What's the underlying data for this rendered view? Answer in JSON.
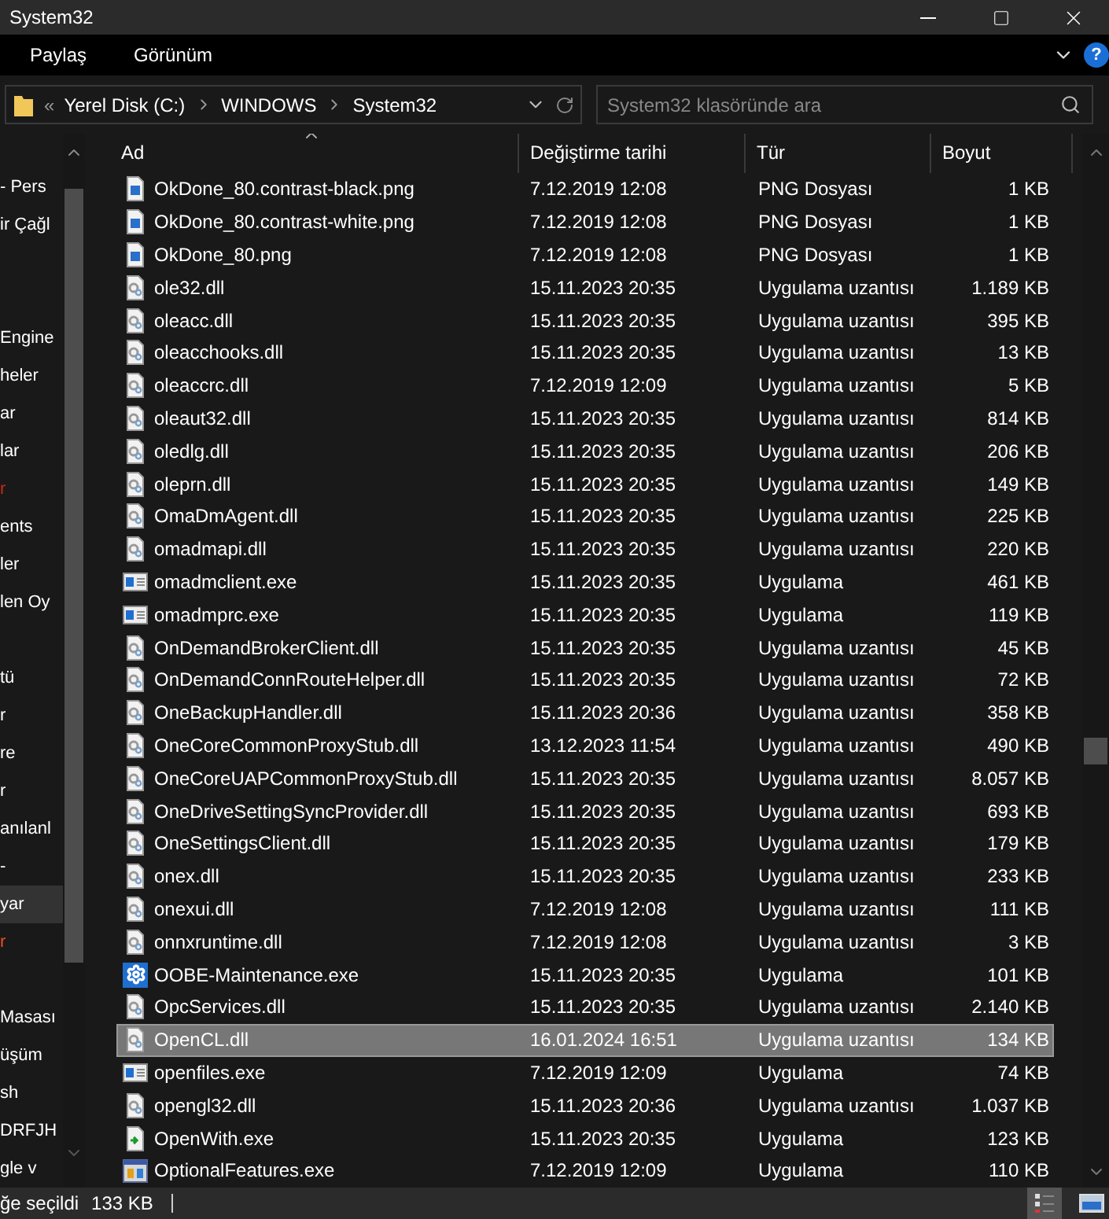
{
  "window": {
    "title": "System32"
  },
  "ribbon": {
    "tabs": [
      {
        "label": "Paylaş",
        "selected": false
      },
      {
        "label": "Görünüm",
        "selected": false
      }
    ],
    "help": "?"
  },
  "address": {
    "overflow": "«",
    "crumbs": [
      "Yerel Disk (C:)",
      "WINDOWS",
      "System32"
    ]
  },
  "search": {
    "placeholder": "System32 klasöründe ara"
  },
  "nav": {
    "items": [
      {
        "kind": "item",
        "label": "- Pers",
        "selected": false
      },
      {
        "kind": "item",
        "label": "ir Çağl",
        "selected": false
      },
      {
        "kind": "gap"
      },
      {
        "kind": "gap"
      },
      {
        "kind": "item",
        "label": "Engine",
        "selected": false
      },
      {
        "kind": "item",
        "label": "heler",
        "selected": false
      },
      {
        "kind": "item",
        "label": "ar",
        "selected": false
      },
      {
        "kind": "item",
        "label": "lar",
        "selected": false
      },
      {
        "kind": "item",
        "label": "r",
        "selected": false,
        "color": "#c42b1c"
      },
      {
        "kind": "item",
        "label": "ents",
        "selected": false
      },
      {
        "kind": "item",
        "label": "ler",
        "selected": false
      },
      {
        "kind": "item",
        "label": "len Oy",
        "selected": false
      },
      {
        "kind": "gap"
      },
      {
        "kind": "item",
        "label": "tü",
        "selected": false
      },
      {
        "kind": "item",
        "label": "r",
        "selected": false
      },
      {
        "kind": "item",
        "label": "re",
        "selected": false
      },
      {
        "kind": "item",
        "label": "r",
        "selected": false
      },
      {
        "kind": "item",
        "label": "anılanl",
        "selected": false
      },
      {
        "kind": "item",
        "label": "-",
        "selected": false
      },
      {
        "kind": "item",
        "label": "yar",
        "selected": true
      },
      {
        "kind": "item",
        "label": "r",
        "selected": false,
        "color": "#e8502a"
      },
      {
        "kind": "gap"
      },
      {
        "kind": "item",
        "label": "Masası",
        "selected": false
      },
      {
        "kind": "item",
        "label": "üşüm",
        "selected": false
      },
      {
        "kind": "item",
        "label": "sh",
        "selected": false
      },
      {
        "kind": "item",
        "label": "DRFJH",
        "selected": false
      },
      {
        "kind": "item",
        "label": "gle v",
        "selected": false
      }
    ]
  },
  "table": {
    "columns": [
      "Ad",
      "Değiştirme tarihi",
      "Tür",
      "Boyut"
    ],
    "rows": [
      {
        "kind": "png",
        "name": "OkDone_80.contrast-black.png",
        "date": "7.12.2019 12:08",
        "type": "PNG Dosyası",
        "size": "1 KB",
        "selected": false
      },
      {
        "kind": "png",
        "name": "OkDone_80.contrast-white.png",
        "date": "7.12.2019 12:08",
        "type": "PNG Dosyası",
        "size": "1 KB",
        "selected": false
      },
      {
        "kind": "png",
        "name": "OkDone_80.png",
        "date": "7.12.2019 12:08",
        "type": "PNG Dosyası",
        "size": "1 KB",
        "selected": false
      },
      {
        "kind": "dll",
        "name": "ole32.dll",
        "date": "15.11.2023 20:35",
        "type": "Uygulama uzantısı",
        "size": "1.189 KB",
        "selected": false
      },
      {
        "kind": "dll",
        "name": "oleacc.dll",
        "date": "15.11.2023 20:35",
        "type": "Uygulama uzantısı",
        "size": "395 KB",
        "selected": false
      },
      {
        "kind": "dll",
        "name": "oleacchooks.dll",
        "date": "15.11.2023 20:35",
        "type": "Uygulama uzantısı",
        "size": "13 KB",
        "selected": false
      },
      {
        "kind": "dll",
        "name": "oleaccrc.dll",
        "date": "7.12.2019 12:09",
        "type": "Uygulama uzantısı",
        "size": "5 KB",
        "selected": false
      },
      {
        "kind": "dll",
        "name": "oleaut32.dll",
        "date": "15.11.2023 20:35",
        "type": "Uygulama uzantısı",
        "size": "814 KB",
        "selected": false
      },
      {
        "kind": "dll",
        "name": "oledlg.dll",
        "date": "15.11.2023 20:35",
        "type": "Uygulama uzantısı",
        "size": "206 KB",
        "selected": false
      },
      {
        "kind": "dll",
        "name": "oleprn.dll",
        "date": "15.11.2023 20:35",
        "type": "Uygulama uzantısı",
        "size": "149 KB",
        "selected": false
      },
      {
        "kind": "dll",
        "name": "OmaDmAgent.dll",
        "date": "15.11.2023 20:35",
        "type": "Uygulama uzantısı",
        "size": "225 KB",
        "selected": false
      },
      {
        "kind": "dll",
        "name": "omadmapi.dll",
        "date": "15.11.2023 20:35",
        "type": "Uygulama uzantısı",
        "size": "220 KB",
        "selected": false
      },
      {
        "kind": "exe",
        "name": "omadmclient.exe",
        "date": "15.11.2023 20:35",
        "type": "Uygulama",
        "size": "461 KB",
        "selected": false
      },
      {
        "kind": "exe",
        "name": "omadmprc.exe",
        "date": "15.11.2023 20:35",
        "type": "Uygulama",
        "size": "119 KB",
        "selected": false
      },
      {
        "kind": "dll",
        "name": "OnDemandBrokerClient.dll",
        "date": "15.11.2023 20:35",
        "type": "Uygulama uzantısı",
        "size": "45 KB",
        "selected": false
      },
      {
        "kind": "dll",
        "name": "OnDemandConnRouteHelper.dll",
        "date": "15.11.2023 20:35",
        "type": "Uygulama uzantısı",
        "size": "72 KB",
        "selected": false
      },
      {
        "kind": "dll",
        "name": "OneBackupHandler.dll",
        "date": "15.11.2023 20:36",
        "type": "Uygulama uzantısı",
        "size": "358 KB",
        "selected": false
      },
      {
        "kind": "dll",
        "name": "OneCoreCommonProxyStub.dll",
        "date": "13.12.2023 11:54",
        "type": "Uygulama uzantısı",
        "size": "490 KB",
        "selected": false
      },
      {
        "kind": "dll",
        "name": "OneCoreUAPCommonProxyStub.dll",
        "date": "15.11.2023 20:35",
        "type": "Uygulama uzantısı",
        "size": "8.057 KB",
        "selected": false
      },
      {
        "kind": "dll",
        "name": "OneDriveSettingSyncProvider.dll",
        "date": "15.11.2023 20:35",
        "type": "Uygulama uzantısı",
        "size": "693 KB",
        "selected": false
      },
      {
        "kind": "dll",
        "name": "OneSettingsClient.dll",
        "date": "15.11.2023 20:35",
        "type": "Uygulama uzantısı",
        "size": "179 KB",
        "selected": false
      },
      {
        "kind": "dll",
        "name": "onex.dll",
        "date": "15.11.2023 20:35",
        "type": "Uygulama uzantısı",
        "size": "233 KB",
        "selected": false
      },
      {
        "kind": "dll",
        "name": "onexui.dll",
        "date": "7.12.2019 12:08",
        "type": "Uygulama uzantısı",
        "size": "111 KB",
        "selected": false
      },
      {
        "kind": "dll",
        "name": "onnxruntime.dll",
        "date": "7.12.2019 12:08",
        "type": "Uygulama uzantısı",
        "size": "3 KB",
        "selected": false
      },
      {
        "kind": "gear",
        "name": "OOBE-Maintenance.exe",
        "date": "15.11.2023 20:35",
        "type": "Uygulama",
        "size": "101 KB",
        "selected": false
      },
      {
        "kind": "dll",
        "name": "OpcServices.dll",
        "date": "15.11.2023 20:35",
        "type": "Uygulama uzantısı",
        "size": "2.140 KB",
        "selected": false
      },
      {
        "kind": "dll",
        "name": "OpenCL.dll",
        "date": "16.01.2024 16:51",
        "type": "Uygulama uzantısı",
        "size": "134 KB",
        "selected": true
      },
      {
        "kind": "exe",
        "name": "openfiles.exe",
        "date": "7.12.2019 12:09",
        "type": "Uygulama",
        "size": "74 KB",
        "selected": false
      },
      {
        "kind": "dll",
        "name": "opengl32.dll",
        "date": "15.11.2023 20:36",
        "type": "Uygulama uzantısı",
        "size": "1.037 KB",
        "selected": false
      },
      {
        "kind": "openwith",
        "name": "OpenWith.exe",
        "date": "15.11.2023 20:35",
        "type": "Uygulama",
        "size": "123 KB",
        "selected": false
      },
      {
        "kind": "features",
        "name": "OptionalFeatures.exe",
        "date": "7.12.2019 12:09",
        "type": "Uygulama",
        "size": "110 KB",
        "selected": false
      }
    ]
  },
  "status_bar": {
    "selection": "ğe seçildi",
    "size": "133 KB",
    "views": [
      {
        "kind": "details",
        "selected": true
      },
      {
        "kind": "large",
        "selected": false
      }
    ]
  }
}
